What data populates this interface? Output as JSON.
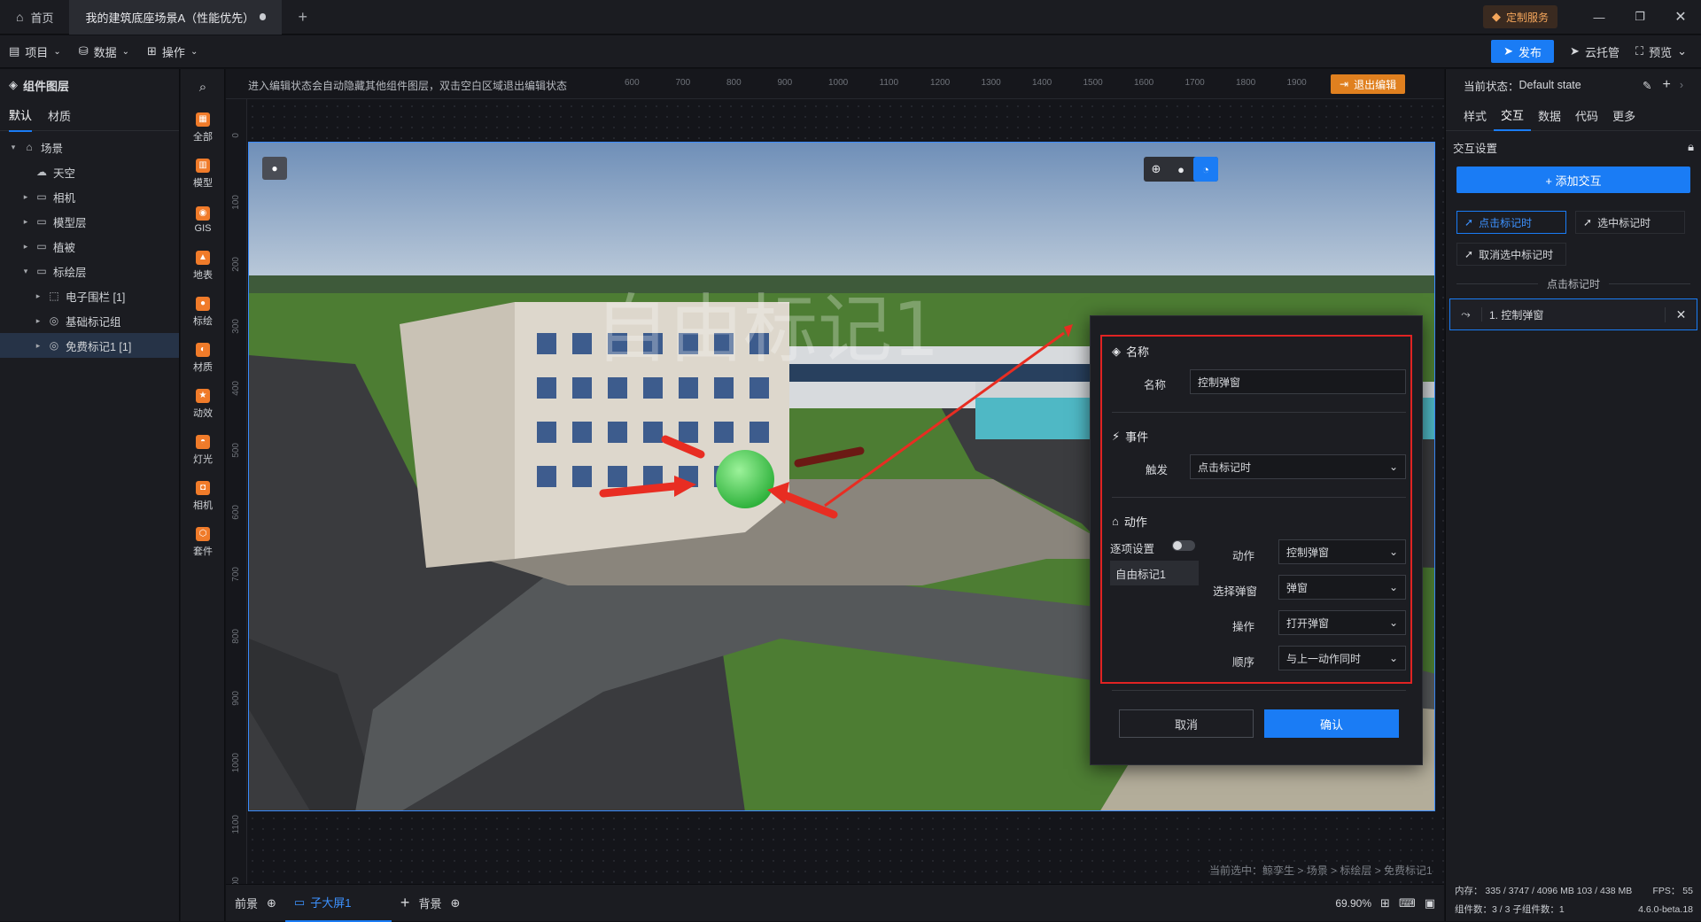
{
  "tabbar": {
    "home_label": "首页",
    "doc_title": "我的建筑底座场景A（性能优先）",
    "new_tab": "+",
    "custom_service": "定制服务"
  },
  "menubar": {
    "project": "项目",
    "data": "数据",
    "operate": "操作",
    "publish": "发布",
    "cloud_host": "云托管",
    "preview": "预览"
  },
  "left_panel": {
    "title": "组件图层",
    "tabs": [
      "默认",
      "材质"
    ],
    "tree": [
      {
        "label": "场景",
        "level": 0,
        "caret": "▾",
        "icon": "scene-icon"
      },
      {
        "label": "天空",
        "level": 1,
        "caret": "",
        "icon": "sky-icon"
      },
      {
        "label": "相机",
        "level": 1,
        "caret": "▸",
        "icon": "folder-icon"
      },
      {
        "label": "模型层",
        "level": 1,
        "caret": "▸",
        "icon": "folder-icon"
      },
      {
        "label": "植被",
        "level": 1,
        "caret": "▸",
        "icon": "folder-icon"
      },
      {
        "label": "标绘层",
        "level": 1,
        "caret": "▾",
        "icon": "folder-icon"
      },
      {
        "label": "电子围栏 [1]",
        "level": 2,
        "caret": "▸",
        "icon": "fence-icon"
      },
      {
        "label": "基础标记组",
        "level": 2,
        "caret": "▸",
        "icon": "marker-icon"
      },
      {
        "label": "免费标记1 [1]",
        "level": 2,
        "caret": "▸",
        "icon": "marker-icon",
        "selected": true
      }
    ]
  },
  "tools": [
    {
      "label": "全部",
      "icon": "grid-icon",
      "color": "#f07b2a"
    },
    {
      "label": "模型",
      "icon": "model-icon",
      "color": "#f07b2a"
    },
    {
      "label": "GIS",
      "icon": "gis-icon",
      "color": "#f07b2a"
    },
    {
      "label": "地表",
      "icon": "terrain-icon",
      "color": "#f07b2a"
    },
    {
      "label": "标绘",
      "icon": "pin-icon",
      "color": "#f07b2a"
    },
    {
      "label": "材质",
      "icon": "material-icon",
      "color": "#f07b2a"
    },
    {
      "label": "动效",
      "icon": "effect-icon",
      "color": "#f07b2a"
    },
    {
      "label": "灯光",
      "icon": "light-icon",
      "color": "#f07b2a"
    },
    {
      "label": "相机",
      "icon": "camera-icon",
      "color": "#f07b2a"
    },
    {
      "label": "套件",
      "icon": "kit-icon",
      "color": "#f07b2a"
    }
  ],
  "canvas": {
    "hint": "进入编辑状态会自动隐藏其他组件图层，双击空白区域退出编辑状态",
    "exit_edit": "退出编辑",
    "ruler_h": [
      "600",
      "700",
      "800",
      "900",
      "1000",
      "1100",
      "1200",
      "1300",
      "1400",
      "1500",
      "1600",
      "1700",
      "1800",
      "1900"
    ],
    "ruler_v": [
      "0",
      "100",
      "200",
      "300",
      "400",
      "500",
      "600",
      "700",
      "800",
      "900",
      "1000",
      "1100",
      "00"
    ],
    "watermark": "自由标记1",
    "breadcrumb_prefix": "当前选中：",
    "breadcrumb": "鲸孪生 > 场景 > 标绘层 > 免费标记1"
  },
  "bottombar": {
    "foreground": "前景",
    "screen": "子大屏1",
    "background": "背景",
    "zoom": "69.90%",
    "memory": "内存：  335 / 3747 / 4096 MB  103 / 438 MB",
    "components": "组件数：3 / 3    子组件数：1",
    "fps": "FPS：  55",
    "version": "4.6.0-beta.18"
  },
  "right_panel": {
    "state_label": "当前状态：",
    "state_value": "Default state",
    "tabs": [
      "样式",
      "交互",
      "数据",
      "代码",
      "更多"
    ],
    "active_tab": 1,
    "section": "交互设置",
    "add_button": "+ 添加交互",
    "chips": [
      "点击标记时",
      "选中标记时",
      "取消选中标记时"
    ],
    "divider_label": "点击标记时",
    "item": "1. 控制弹窗"
  },
  "dialog": {
    "name_section": "名称",
    "name_label": "名称",
    "name_value": "控制弹窗",
    "event_section": "事件",
    "trigger_label": "触发",
    "trigger_value": "点击标记时",
    "action_section": "动作",
    "per_item_label": "逐项设置",
    "target_item": "自由标记1",
    "action_label": "动作",
    "action_value": "控制弹窗",
    "popup_label": "选择弹窗",
    "popup_value": "弹窗",
    "op_label": "操作",
    "op_value": "打开弹窗",
    "order_label": "顺序",
    "order_value": "与上一动作同时",
    "cancel": "取消",
    "confirm": "确认"
  }
}
